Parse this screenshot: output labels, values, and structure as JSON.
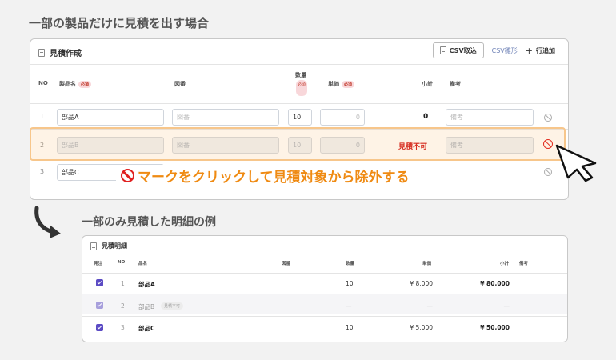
{
  "headings": {
    "top": "一部の製品だけに見積を出す場合",
    "bottom": "一部のみ見積した明細の例"
  },
  "form": {
    "title": "見積作成",
    "csv_import": "CSV取込",
    "csv_template": "CSV雛形",
    "add_row": "行追加",
    "headers": {
      "no": "NO",
      "product": "製品名",
      "required": "必須",
      "drawing": "図番",
      "qty_line1": "数量",
      "unit_price": "単価",
      "subtotal": "小計",
      "remarks": "備考"
    },
    "placeholders": {
      "drawing": "図番",
      "remarks": "備考",
      "unit_price": "0"
    },
    "rows": [
      {
        "no": "1",
        "product": "部品A",
        "qty": "10",
        "subtotal": "0"
      },
      {
        "no": "2",
        "product": "部品B",
        "qty": "10",
        "status": "見積不可"
      },
      {
        "no": "3",
        "product": "部品C"
      }
    ]
  },
  "callout": "マークをクリックして見積対象から除外する",
  "detail": {
    "title": "見積明細",
    "headers": {
      "order": "発注",
      "no": "NO",
      "product": "品名",
      "drawing": "図番",
      "qty": "数量",
      "unit_price": "単価",
      "subtotal": "小計",
      "remarks": "備考"
    },
    "rows": [
      {
        "no": "1",
        "product": "部品A",
        "qty": "10",
        "unit_price": "¥ 8,000",
        "subtotal": "¥ 80,000"
      },
      {
        "no": "2",
        "product": "部品B",
        "badge": "見積不可",
        "qty": "—",
        "unit_price": "—",
        "subtotal": "—"
      },
      {
        "no": "3",
        "product": "部品C",
        "qty": "10",
        "unit_price": "¥ 5,000",
        "subtotal": "¥ 50,000"
      }
    ]
  },
  "colors": {
    "accent": "#ef8a12",
    "danger": "#d00000",
    "checkbox": "#5b4bc4"
  }
}
